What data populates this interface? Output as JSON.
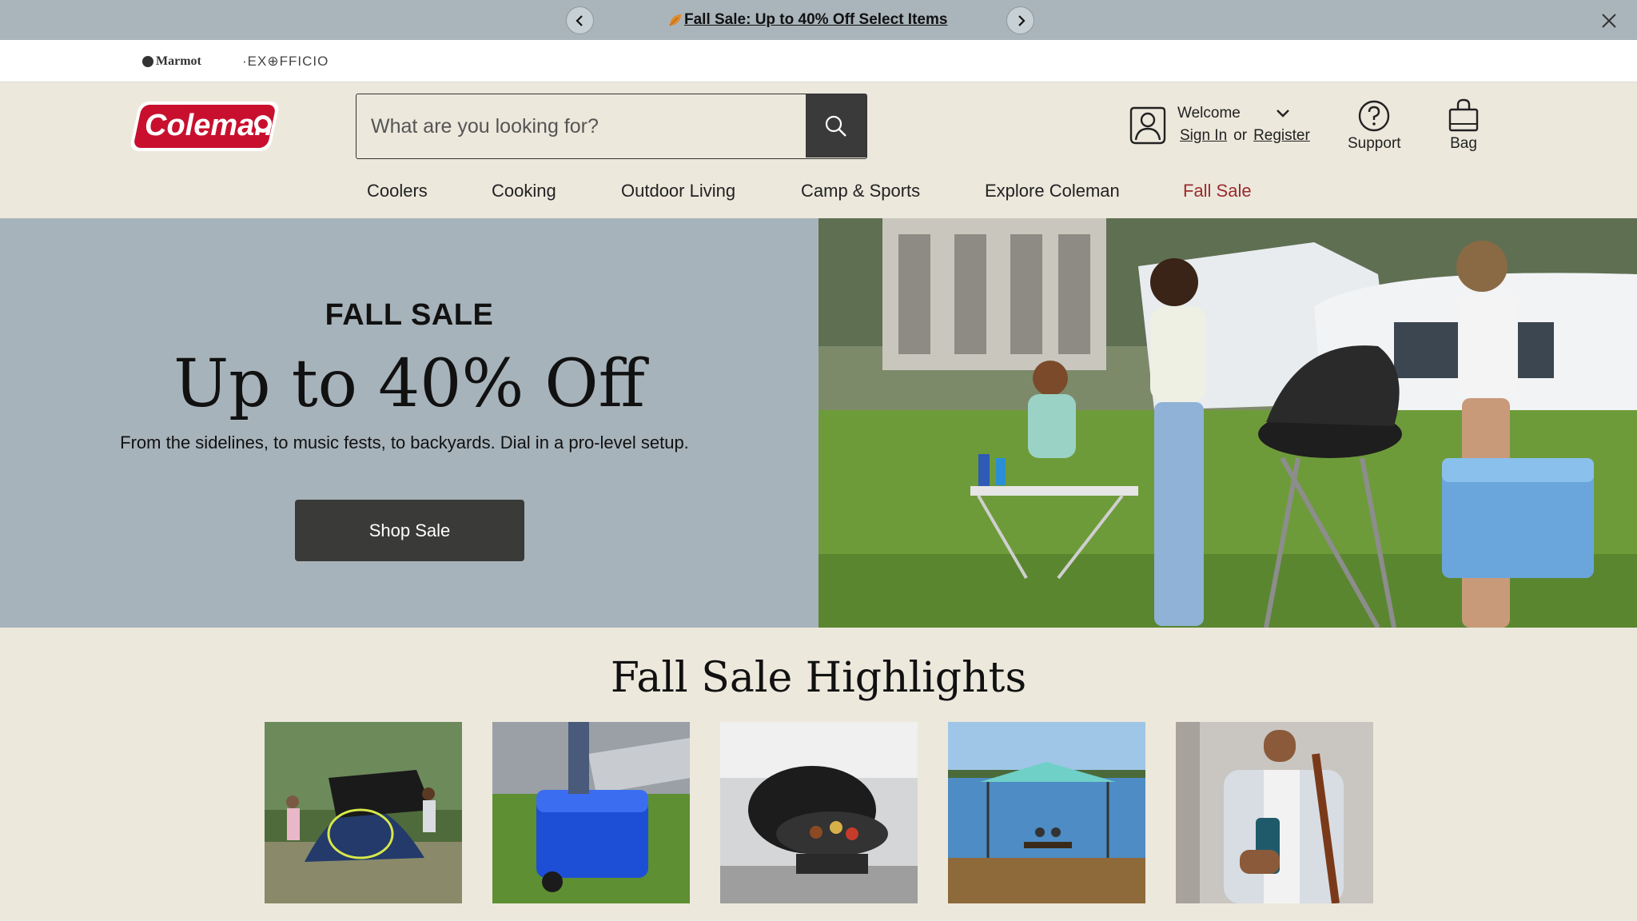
{
  "promo": {
    "message": "Fall Sale: Up to 40% Off Select Items",
    "prev_icon": "chevron-left-icon",
    "next_icon": "chevron-right-icon",
    "close_icon": "close-icon"
  },
  "brands": {
    "marmot": "Marmot",
    "exofficio": "·EX⊕FFICIO"
  },
  "header": {
    "logo_text": "Coleman",
    "search_placeholder": "What are you looking for?",
    "welcome": "Welcome",
    "sign_in": "Sign In",
    "or": "or",
    "register": "Register",
    "support": "Support",
    "bag": "Bag"
  },
  "nav": {
    "items": [
      "Coolers",
      "Cooking",
      "Outdoor Living",
      "Camp & Sports",
      "Explore Coleman",
      "Fall Sale"
    ]
  },
  "hero": {
    "kicker": "FALL SALE",
    "title": "Up to 40% Off",
    "subtitle": "From the sidelines, to music fests, to backyards. Dial in a pro-level setup.",
    "cta": "Shop Sale"
  },
  "highlights": {
    "title": "Fall Sale Highlights"
  },
  "colors": {
    "promo_bg": "#a9b5bb",
    "page_bg": "#ece8dc",
    "hero_bg": "#a7b3ba",
    "brand_red": "#c8102e",
    "sale_link": "#9d2a2d",
    "button_dark": "#3a3a38"
  }
}
